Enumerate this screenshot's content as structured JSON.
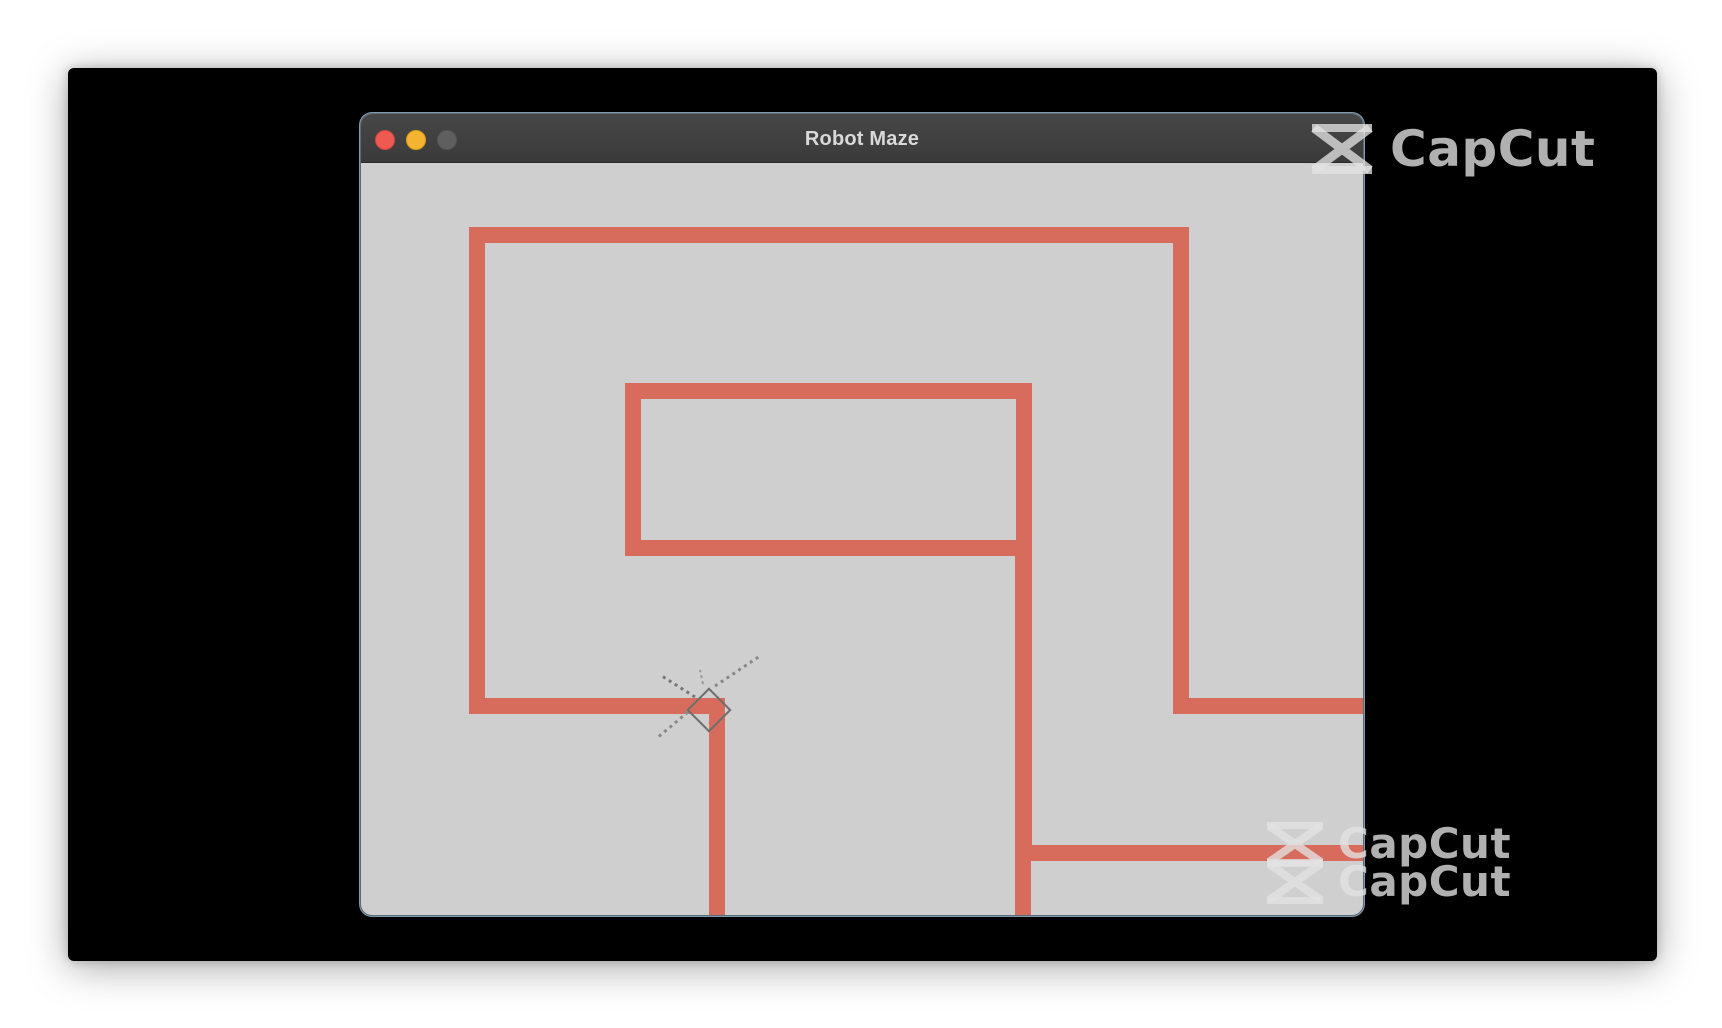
{
  "window": {
    "title": "Robot Maze"
  },
  "colors": {
    "wall": "#d86c5c",
    "floor": "#cfcfcf",
    "robot": "#6e6e6e"
  },
  "watermark": {
    "text": "CapCut",
    "icon": "capcut-logo-icon"
  }
}
